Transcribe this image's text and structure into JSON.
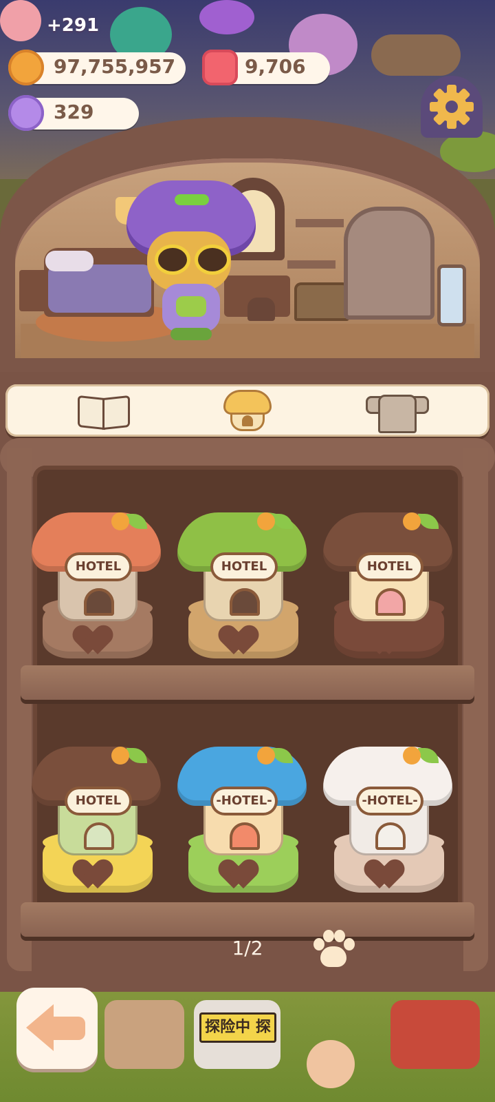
{
  "hud": {
    "gain": "+291",
    "coins": "97,755,957",
    "gems": "9,706",
    "candy": "329"
  },
  "tabs": [
    {
      "name": "book-tab",
      "icon": "book-icon",
      "selected": false
    },
    {
      "name": "hotel-tab",
      "icon": "hotel-icon",
      "selected": true
    },
    {
      "name": "clothes-tab",
      "icon": "shirt-icon",
      "selected": false
    }
  ],
  "hotels": [
    {
      "sign": "HOTEL",
      "cap": "#e47f5a",
      "house": "#d9c4ad",
      "pedestal": "#a57a62",
      "door": "#6a4a3a"
    },
    {
      "sign": "HOTEL",
      "cap": "#8fc046",
      "house": "#e8d4b0",
      "pedestal": "#d2a56c",
      "door": "#6a4a3a"
    },
    {
      "sign": "HOTEL",
      "cap": "#7a4f3c",
      "house": "#f7e0b6",
      "pedestal": "#7a4a3a",
      "door": "#f2a6a6"
    },
    {
      "sign": "HOTEL",
      "cap": "#7a4f3c",
      "house": "#c8dc9a",
      "pedestal": "#f3d456",
      "door": "#d9e6c0"
    },
    {
      "sign": "-HOTEL-",
      "cap": "#4aa6e0",
      "house": "#f7dcae",
      "pedestal": "#9ccf5a",
      "door": "#f28a6a"
    },
    {
      "sign": "-HOTEL-",
      "cap": "#f6f0ec",
      "house": "#f1ebe6",
      "pedestal": "#e4c9b6",
      "door": "#f4f0ea"
    }
  ],
  "pager": {
    "text": "1/2"
  },
  "bottom": {
    "adventure_sign": "探险中 探"
  },
  "colors": {
    "accent": "#7a5446",
    "cream": "#fdf3e2"
  }
}
